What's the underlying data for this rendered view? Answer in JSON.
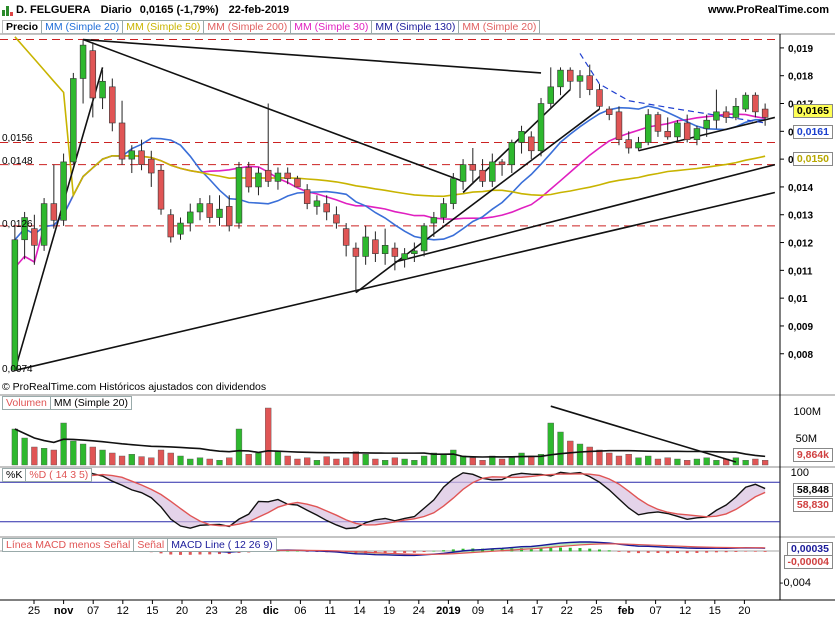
{
  "header": {
    "instrument": "D. FELGUERA",
    "period": "Diario",
    "last": "0,0165 (-1,79%)",
    "date": "22-feb-2019",
    "site": "www.ProRealTime.com"
  },
  "legends": {
    "price_label": "Precio",
    "price": [
      {
        "label": "MM (Simple 20)",
        "color": "#1f6fd8"
      },
      {
        "label": "MM (Simple 50)",
        "color": "#c8b400"
      },
      {
        "label": "MM (Simple 200)",
        "color": "#e06060"
      },
      {
        "label": "MM (Simple 30)",
        "color": "#e020c0"
      },
      {
        "label": "MM (Simple 130)",
        "color": "#1a1a9a"
      },
      {
        "label": "MM (Simple 20)",
        "color": "#e06060"
      }
    ],
    "copyright": "© ProRealTime.com  Históricos ajustados con dividendos",
    "volume": [
      "Volumen",
      "MM (Simple 20)"
    ],
    "stoch": [
      "%K",
      "%D ( 14 3 5)"
    ],
    "macd": [
      "Línea MACD menos Señal",
      "Señal",
      "MACD Line ( 12 26 9)"
    ]
  },
  "price_axis": [
    "0,019",
    "0,018",
    "0,017",
    "0,016",
    "0,015",
    "0,014",
    "0,013",
    "0,012",
    "0,011",
    "0,01",
    "0,009",
    "0,008"
  ],
  "left_labels": [
    "0,0156",
    "0,0148",
    "0,0126",
    "0,0074"
  ],
  "price_tags": [
    {
      "text": "0,0165",
      "color": "#000000",
      "bg": "#ffff55"
    },
    {
      "text": "0,0161",
      "color": "#1a3fcf",
      "bg": "#ffffff"
    },
    {
      "text": "0,0150",
      "color": "#b8a800",
      "bg": "#ffffff"
    }
  ],
  "volume_axis": [
    "100M",
    "50M"
  ],
  "volume_tags": [
    {
      "text": "9,864k",
      "color": "#d04040"
    }
  ],
  "stoch_axis": [
    "100"
  ],
  "stoch_tags": [
    {
      "text": "58,848",
      "color": "#000000"
    },
    {
      "text": "58,830",
      "color": "#d04040"
    }
  ],
  "macd_axis": [
    "-0,004"
  ],
  "macd_tags": [
    {
      "text": "0,00035",
      "color": "#1a1a9a"
    },
    {
      "text": "-0,00004",
      "color": "#d04040"
    }
  ],
  "x_labels": [
    "25",
    "nov",
    "07",
    "12",
    "15",
    "20",
    "23",
    "28",
    "dic",
    "06",
    "11",
    "14",
    "19",
    "24",
    "2019",
    "09",
    "14",
    "17",
    "22",
    "25",
    "feb",
    "07",
    "12",
    "15",
    "20"
  ],
  "chart_data": {
    "type": "candlestick",
    "title": "D. FELGUERA",
    "ylim": [
      0.0072,
      0.0195
    ],
    "candles": [
      {
        "o": 0.0074,
        "h": 0.0126,
        "l": 0.0074,
        "c": 0.0121
      },
      {
        "o": 0.0121,
        "h": 0.0131,
        "l": 0.0114,
        "c": 0.0129
      },
      {
        "o": 0.0125,
        "h": 0.013,
        "l": 0.0112,
        "c": 0.0119
      },
      {
        "o": 0.0119,
        "h": 0.0136,
        "l": 0.0117,
        "c": 0.0134
      },
      {
        "o": 0.0134,
        "h": 0.0148,
        "l": 0.0125,
        "c": 0.0128
      },
      {
        "o": 0.0128,
        "h": 0.0152,
        "l": 0.0126,
        "c": 0.0149
      },
      {
        "o": 0.0149,
        "h": 0.0181,
        "l": 0.0148,
        "c": 0.0179
      },
      {
        "o": 0.0179,
        "h": 0.0193,
        "l": 0.017,
        "c": 0.0191
      },
      {
        "o": 0.0189,
        "h": 0.0192,
        "l": 0.0165,
        "c": 0.0172
      },
      {
        "o": 0.0172,
        "h": 0.0182,
        "l": 0.0168,
        "c": 0.0178
      },
      {
        "o": 0.0176,
        "h": 0.0179,
        "l": 0.016,
        "c": 0.0163
      },
      {
        "o": 0.0163,
        "h": 0.0171,
        "l": 0.0148,
        "c": 0.015
      },
      {
        "o": 0.015,
        "h": 0.0155,
        "l": 0.0145,
        "c": 0.0153
      },
      {
        "o": 0.0153,
        "h": 0.0157,
        "l": 0.0146,
        "c": 0.0148
      },
      {
        "o": 0.015,
        "h": 0.0153,
        "l": 0.014,
        "c": 0.0145
      },
      {
        "o": 0.0146,
        "h": 0.0148,
        "l": 0.013,
        "c": 0.0132
      },
      {
        "o": 0.013,
        "h": 0.0132,
        "l": 0.012,
        "c": 0.0122
      },
      {
        "o": 0.0123,
        "h": 0.0129,
        "l": 0.0121,
        "c": 0.0127
      },
      {
        "o": 0.0127,
        "h": 0.0134,
        "l": 0.0124,
        "c": 0.0131
      },
      {
        "o": 0.0131,
        "h": 0.0136,
        "l": 0.0128,
        "c": 0.0134
      },
      {
        "o": 0.0134,
        "h": 0.0137,
        "l": 0.0127,
        "c": 0.0129
      },
      {
        "o": 0.0129,
        "h": 0.0137,
        "l": 0.0126,
        "c": 0.0132
      },
      {
        "o": 0.0133,
        "h": 0.0137,
        "l": 0.0124,
        "c": 0.0126
      },
      {
        "o": 0.0127,
        "h": 0.0149,
        "l": 0.0125,
        "c": 0.0147
      },
      {
        "o": 0.0147,
        "h": 0.0149,
        "l": 0.0138,
        "c": 0.014
      },
      {
        "o": 0.014,
        "h": 0.0147,
        "l": 0.0137,
        "c": 0.0145
      },
      {
        "o": 0.0146,
        "h": 0.017,
        "l": 0.014,
        "c": 0.0142
      },
      {
        "o": 0.0142,
        "h": 0.0147,
        "l": 0.0139,
        "c": 0.0145
      },
      {
        "o": 0.0145,
        "h": 0.0147,
        "l": 0.0141,
        "c": 0.0143
      },
      {
        "o": 0.0143,
        "h": 0.0144,
        "l": 0.014,
        "c": 0.014
      },
      {
        "o": 0.0139,
        "h": 0.0141,
        "l": 0.0132,
        "c": 0.0134
      },
      {
        "o": 0.0133,
        "h": 0.0137,
        "l": 0.013,
        "c": 0.0135
      },
      {
        "o": 0.0134,
        "h": 0.0137,
        "l": 0.0128,
        "c": 0.0131
      },
      {
        "o": 0.013,
        "h": 0.0133,
        "l": 0.0125,
        "c": 0.0127
      },
      {
        "o": 0.0125,
        "h": 0.0127,
        "l": 0.0115,
        "c": 0.0119
      },
      {
        "o": 0.0118,
        "h": 0.012,
        "l": 0.0102,
        "c": 0.0115
      },
      {
        "o": 0.0115,
        "h": 0.0126,
        "l": 0.0112,
        "c": 0.0122
      },
      {
        "o": 0.0121,
        "h": 0.0124,
        "l": 0.0113,
        "c": 0.0116
      },
      {
        "o": 0.0116,
        "h": 0.0125,
        "l": 0.0112,
        "c": 0.0119
      },
      {
        "o": 0.0118,
        "h": 0.012,
        "l": 0.011,
        "c": 0.0115
      },
      {
        "o": 0.0114,
        "h": 0.0118,
        "l": 0.0111,
        "c": 0.0116
      },
      {
        "o": 0.0116,
        "h": 0.012,
        "l": 0.0113,
        "c": 0.0117
      },
      {
        "o": 0.0117,
        "h": 0.0127,
        "l": 0.0115,
        "c": 0.0126
      },
      {
        "o": 0.0127,
        "h": 0.0131,
        "l": 0.0122,
        "c": 0.0129
      },
      {
        "o": 0.0129,
        "h": 0.0136,
        "l": 0.0127,
        "c": 0.0134
      },
      {
        "o": 0.0134,
        "h": 0.0145,
        "l": 0.0132,
        "c": 0.0143
      },
      {
        "o": 0.0142,
        "h": 0.015,
        "l": 0.0139,
        "c": 0.0148
      },
      {
        "o": 0.0148,
        "h": 0.0154,
        "l": 0.0141,
        "c": 0.0146
      },
      {
        "o": 0.0146,
        "h": 0.015,
        "l": 0.014,
        "c": 0.0142
      },
      {
        "o": 0.0142,
        "h": 0.0152,
        "l": 0.014,
        "c": 0.0149
      },
      {
        "o": 0.0149,
        "h": 0.015,
        "l": 0.0144,
        "c": 0.0148
      },
      {
        "o": 0.0148,
        "h": 0.0157,
        "l": 0.0145,
        "c": 0.0156
      },
      {
        "o": 0.0156,
        "h": 0.0162,
        "l": 0.0152,
        "c": 0.016
      },
      {
        "o": 0.0158,
        "h": 0.016,
        "l": 0.015,
        "c": 0.0153
      },
      {
        "o": 0.0153,
        "h": 0.0172,
        "l": 0.0151,
        "c": 0.017
      },
      {
        "o": 0.017,
        "h": 0.0183,
        "l": 0.0168,
        "c": 0.0176
      },
      {
        "o": 0.0176,
        "h": 0.0183,
        "l": 0.0173,
        "c": 0.0182
      },
      {
        "o": 0.0182,
        "h": 0.0183,
        "l": 0.0175,
        "c": 0.0178
      },
      {
        "o": 0.0178,
        "h": 0.0182,
        "l": 0.0172,
        "c": 0.018
      },
      {
        "o": 0.018,
        "h": 0.0184,
        "l": 0.0173,
        "c": 0.0175
      },
      {
        "o": 0.0175,
        "h": 0.0177,
        "l": 0.0168,
        "c": 0.0169
      },
      {
        "o": 0.0168,
        "h": 0.0169,
        "l": 0.0164,
        "c": 0.0166
      },
      {
        "o": 0.0167,
        "h": 0.0169,
        "l": 0.0155,
        "c": 0.0157
      },
      {
        "o": 0.0157,
        "h": 0.016,
        "l": 0.0152,
        "c": 0.0154
      },
      {
        "o": 0.0154,
        "h": 0.0158,
        "l": 0.0153,
        "c": 0.0156
      },
      {
        "o": 0.0156,
        "h": 0.0168,
        "l": 0.0155,
        "c": 0.0166
      },
      {
        "o": 0.0166,
        "h": 0.0167,
        "l": 0.0158,
        "c": 0.016
      },
      {
        "o": 0.016,
        "h": 0.0165,
        "l": 0.0157,
        "c": 0.0158
      },
      {
        "o": 0.0158,
        "h": 0.0164,
        "l": 0.0156,
        "c": 0.0163
      },
      {
        "o": 0.0163,
        "h": 0.0166,
        "l": 0.0156,
        "c": 0.0157
      },
      {
        "o": 0.0157,
        "h": 0.0162,
        "l": 0.0155,
        "c": 0.0161
      },
      {
        "o": 0.0161,
        "h": 0.0166,
        "l": 0.0158,
        "c": 0.0164
      },
      {
        "o": 0.0164,
        "h": 0.0175,
        "l": 0.0161,
        "c": 0.0167
      },
      {
        "o": 0.0167,
        "h": 0.0169,
        "l": 0.0163,
        "c": 0.0165
      },
      {
        "o": 0.0165,
        "h": 0.0172,
        "l": 0.0164,
        "c": 0.0169
      },
      {
        "o": 0.0168,
        "h": 0.0174,
        "l": 0.0167,
        "c": 0.0173
      },
      {
        "o": 0.0173,
        "h": 0.0174,
        "l": 0.0165,
        "c": 0.0167
      },
      {
        "o": 0.0168,
        "h": 0.017,
        "l": 0.0162,
        "c": 0.0165
      }
    ],
    "horizontal_levels": [
      0.0193,
      0.0156,
      0.0148,
      0.0126
    ],
    "level_color": "#cc2222",
    "up_color": "#2eb82e",
    "down_color": "#e05555"
  }
}
